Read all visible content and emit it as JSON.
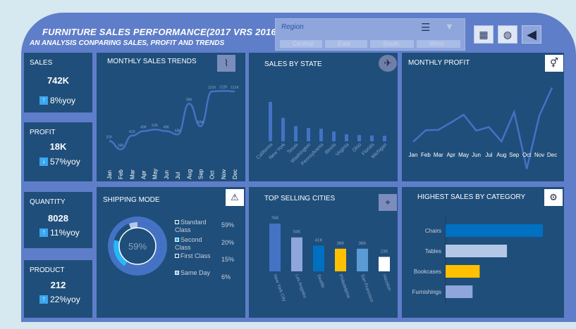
{
  "header": {
    "title": "FURNITURE SALES PERFORMANCE(2017 VRS 2016)",
    "subtitle": "AN ANALYSIS CONPARING SALES, PROFIT AND TRENDS"
  },
  "slicer": {
    "title": "Region",
    "options": [
      "Central",
      "East",
      "South",
      "West"
    ]
  },
  "nav": {
    "icons": [
      "table-icon",
      "globe-icon",
      "back-arrow-icon"
    ]
  },
  "kpis": {
    "sales": {
      "label": "SALES",
      "value": "742K",
      "yoy": "8%yoy",
      "direction": "up"
    },
    "profit": {
      "label": "PROFIT",
      "value": "18K",
      "yoy": "57%yoy",
      "direction": "down"
    },
    "quantity": {
      "label": "QUANTITY",
      "value": "8028",
      "yoy": "11%yoy",
      "direction": "up"
    },
    "product": {
      "label": "PRODUCT",
      "value": "212",
      "yoy": "22%yoy",
      "direction": "up"
    }
  },
  "monthly_sales": {
    "title": "MONTHLY SALES TRENDS"
  },
  "sales_by_state": {
    "title": "SALES BY STATE"
  },
  "monthly_profit": {
    "title": "MONTHLY PROFIT"
  },
  "shipping": {
    "title": "SHIPPING MODE",
    "center": "59%",
    "rows": [
      {
        "label": "Standard Class",
        "pct": "59%",
        "color": "#ffffff"
      },
      {
        "label": "Second Class",
        "pct": "20%",
        "color": "#29b6f6"
      },
      {
        "label": "First Class",
        "pct": "15%",
        "color": "#1f4e7a"
      },
      {
        "label": "Same Day",
        "pct": "6%",
        "color": "#8ea6dc"
      }
    ]
  },
  "top_cities": {
    "title": "TOP SELLING CITIES"
  },
  "category": {
    "title": "HIGHEST SALES BY CATEGORY"
  },
  "chart_data": [
    {
      "type": "line",
      "title": "MONTHLY SALES TRENDS",
      "categories": [
        "Jan",
        "Feb",
        "Mar",
        "Apr",
        "May",
        "Jun",
        "Jul",
        "Aug",
        "Sep",
        "Oct",
        "Nov",
        "Dec"
      ],
      "series": [
        {
          "values": [
            31,
            16,
            41,
            49,
            52,
            49,
            43,
            99,
            58,
            121,
            122,
            121
          ]
        }
      ],
      "data_labels": [
        "31K",
        "16K",
        "41K",
        "49K",
        "52K",
        "49K",
        "43K",
        "99K",
        "58K",
        "121K",
        "122K",
        "121K"
      ],
      "ylim": [
        0,
        130
      ]
    },
    {
      "type": "bar",
      "title": "SALES BY STATE",
      "categories": [
        "California",
        "New York",
        "Texas",
        "Washington",
        "Pennsylvania",
        "Illinois",
        "Virginia",
        "Ohio",
        "Florida",
        "Michigan"
      ],
      "values": [
        156,
        93,
        60,
        53,
        50,
        39,
        28,
        25,
        23,
        22
      ]
    },
    {
      "type": "line",
      "title": "MONTHLY PROFIT",
      "categories": [
        "Jan",
        "Feb",
        "Mar",
        "Apr",
        "May",
        "Jun",
        "Jul",
        "Aug",
        "Sep",
        "Oct",
        "Nov",
        "Dec"
      ],
      "series": [
        {
          "values": [
            1.5,
            4.5,
            4.6,
            6.5,
            8.5,
            4.4,
            5.3,
            1.6,
            9.2,
            -5.5,
            8.3,
            15.5
          ]
        }
      ]
    },
    {
      "type": "bar",
      "title": "TOP SELLING CITIES",
      "categories": [
        "New York City",
        "Los Angeles",
        "Seattle",
        "Philadelphia",
        "San Francisco",
        "Houston"
      ],
      "values": [
        76,
        54,
        41,
        36,
        36,
        23
      ],
      "data_labels": [
        "76K",
        "54K",
        "41K",
        "36K",
        "36K",
        "23K"
      ],
      "colors": [
        "#4472c4",
        "#8ea6dc",
        "#0070c0",
        "#ffc000",
        "#5b9bd5",
        "#ffffff"
      ]
    },
    {
      "type": "pie",
      "title": "SHIPPING MODE",
      "categories": [
        "Standard Class",
        "Second Class",
        "First Class",
        "Same Day"
      ],
      "values": [
        59,
        20,
        15,
        6
      ]
    },
    {
      "type": "bar",
      "title": "HIGHEST SALES BY CATEGORY",
      "categories": [
        "Chairs",
        "Tables",
        "Bookcases",
        "Furnishings"
      ],
      "values": [
        328,
        207,
        115,
        91
      ],
      "colors": [
        "#0070c0",
        "#b4c7e7",
        "#ffc000",
        "#8ea6dc"
      ]
    }
  ]
}
